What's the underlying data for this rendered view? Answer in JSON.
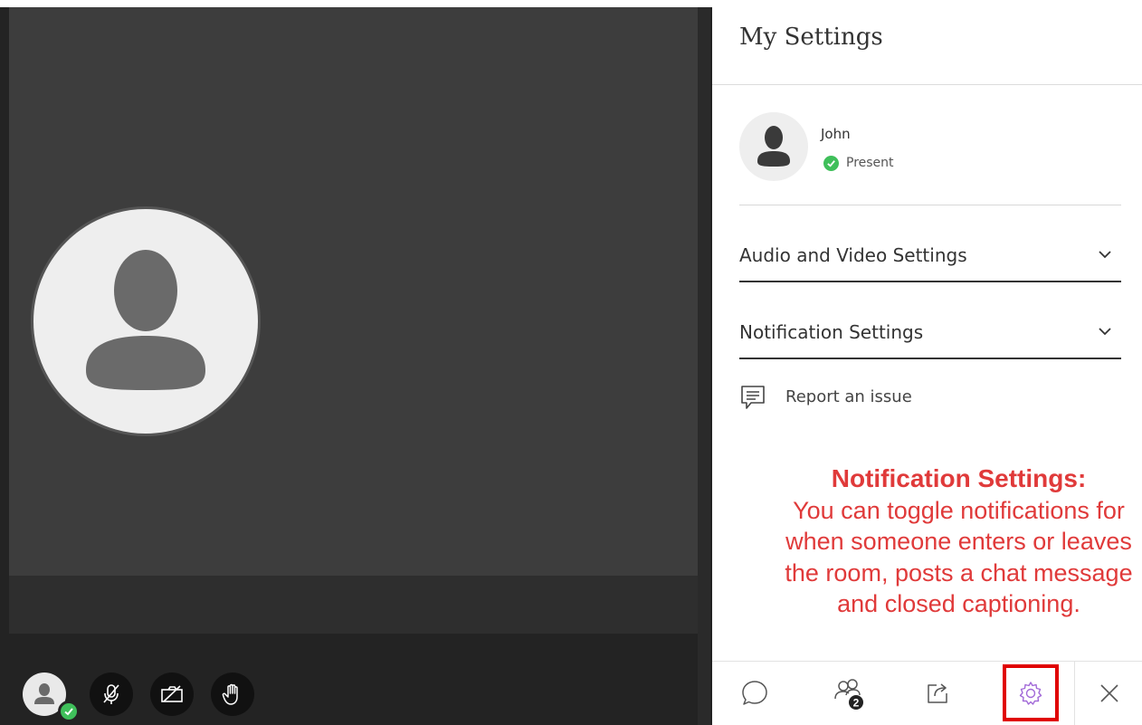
{
  "video": {
    "participant_avatar_icon": "person-icon"
  },
  "controls": {
    "avatar_icon": "person-icon",
    "status_icon": "check-icon",
    "microphone_icon": "microphone-muted-icon",
    "camera_icon": "camera-off-icon",
    "hand_icon": "raise-hand-icon"
  },
  "panel": {
    "title": "My Settings",
    "user": {
      "name": "John",
      "status": "Present"
    },
    "sections": [
      {
        "label": "Audio and Video Settings"
      },
      {
        "label": "Notification Settings"
      }
    ],
    "report_label": "Report an issue",
    "callout": {
      "title": "Notification Settings:",
      "body": "You can toggle notifications for when someone enters or leaves the room, posts a chat message and closed captioning."
    },
    "nav": {
      "participants_count": "2",
      "icons": [
        "chat-icon",
        "participants-icon",
        "share-content-icon",
        "settings-icon",
        "close-icon"
      ]
    }
  },
  "colors": {
    "stage_bg": "#3d3d3d",
    "present_green": "#3fbf5a",
    "callout_red": "#e03a3a",
    "highlight_red": "#e00000",
    "settings_purple": "#a26ad8"
  }
}
